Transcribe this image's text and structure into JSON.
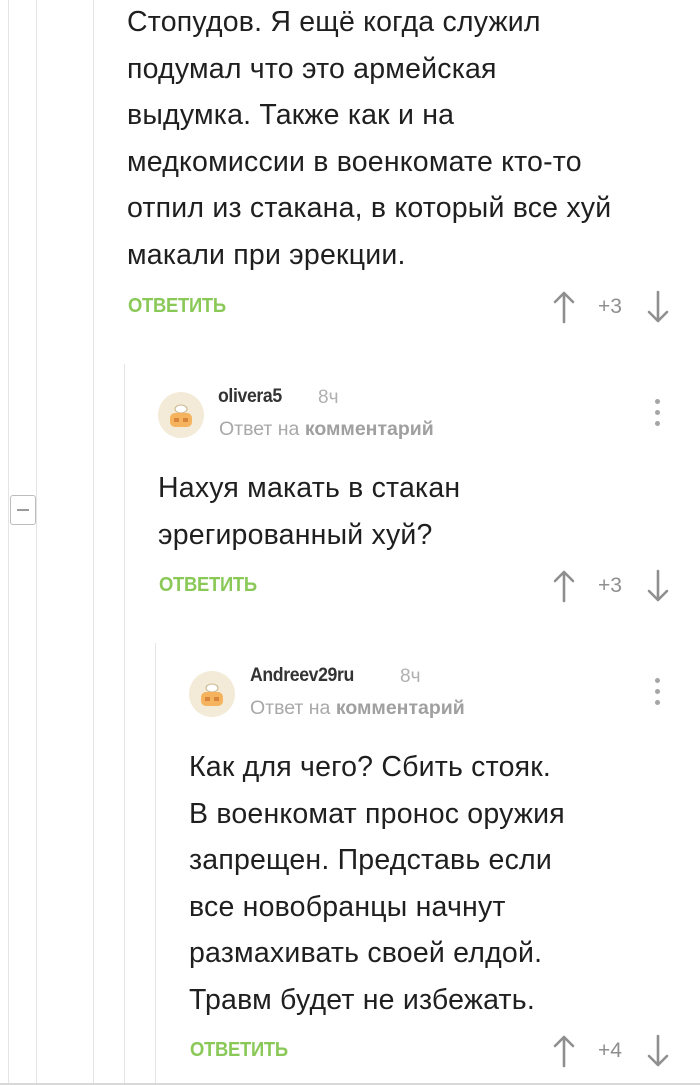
{
  "comments": [
    {
      "text": "Стопудов. Я ещё когда служил\nподумал что это армейская\nвыдумка. Также как и на\nмедкомиссии в военкомате кто-то\nотпил из стакана, в который все хуй\nмакали при эрекции.",
      "reply_label": "ОТВЕТИТЬ",
      "score": "+3"
    },
    {
      "username": "olivera5",
      "time": "8ч",
      "reply_to_prefix": "Ответ на",
      "reply_to_link": "комментарий",
      "text": "Нахуя макать в стакан\nэрегированный хуй?",
      "reply_label": "ОТВЕТИТЬ",
      "score": "+3"
    },
    {
      "username": "Andreev29ru",
      "time": "8ч",
      "reply_to_prefix": "Ответ на",
      "reply_to_link": "комментарий",
      "text": "Как для чего? Сбить стояк.\nВ военкомат пронос оружия\nзапрещен. Представь если\nвсе новобранцы начнут\nразмахивать своей елдой.\nТравм будет не избежать.",
      "reply_label": "ОТВЕТИТЬ",
      "score": "+4"
    }
  ],
  "icons": {
    "upvote": "arrow-up-icon",
    "downvote": "arrow-down-icon",
    "menu": "kebab-menu-icon",
    "collapse": "minus-collapse-icon",
    "avatar": "default-chef-avatar"
  },
  "colors": {
    "reply_green": "#8ac858",
    "score_gray": "#8f8f8f",
    "thread_line": "#e4e4e4"
  }
}
